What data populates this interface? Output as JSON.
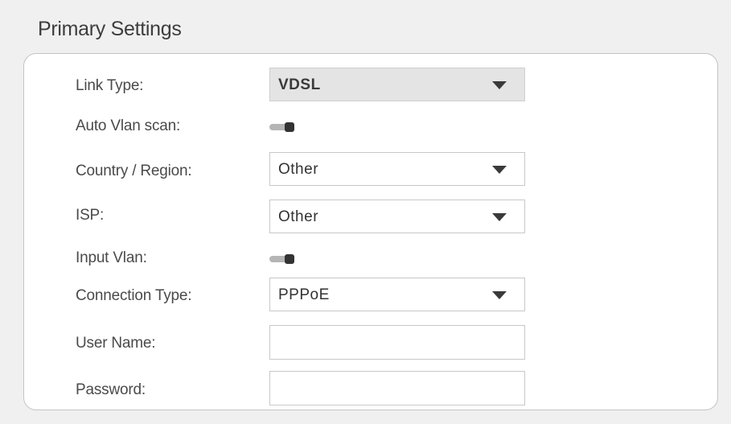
{
  "section": {
    "title": "Primary Settings"
  },
  "form": {
    "link_type": {
      "label": "Link Type:",
      "value": "VDSL"
    },
    "auto_vlan_scan": {
      "label": "Auto Vlan scan:",
      "state": "off"
    },
    "country_region": {
      "label": "Country / Region:",
      "value": "Other"
    },
    "isp": {
      "label": "ISP:",
      "value": "Other"
    },
    "input_vlan": {
      "label": "Input Vlan:",
      "state": "off"
    },
    "connection_type": {
      "label": "Connection Type:",
      "value": "PPPoE"
    },
    "user_name": {
      "label": "User Name:",
      "value": "",
      "placeholder": ""
    },
    "password": {
      "label": "Password:",
      "value": "",
      "placeholder": ""
    }
  },
  "icons": {
    "dropdown": "chevron-down-icon"
  },
  "colors": {
    "page_background": "#f0f0f0",
    "panel_background": "#ffffff",
    "disabled_select_background": "#e4e4e4",
    "toggle_track": "#b5b5b5",
    "toggle_knob": "#333333"
  }
}
